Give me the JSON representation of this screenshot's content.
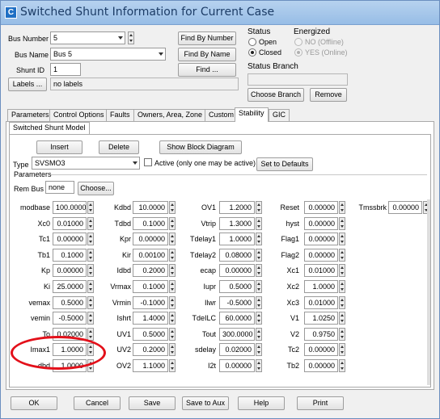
{
  "window": {
    "title": "Switched Shunt Information for Current Case",
    "app_icon_glyph": "C"
  },
  "bus_number": {
    "label": "Bus Number",
    "value": "5"
  },
  "bus_name": {
    "label": "Bus Name",
    "value": "Bus 5"
  },
  "shunt_id": {
    "label": "Shunt ID",
    "value": "1"
  },
  "labels": {
    "button": "Labels ...",
    "value": "no labels"
  },
  "find": {
    "by_number": "Find By Number",
    "by_name": "Find By Name",
    "find": "Find ..."
  },
  "status": {
    "title": "Status",
    "open": "Open",
    "closed": "Closed"
  },
  "energized": {
    "title": "Energized",
    "no": "NO (Offline)",
    "yes": "YES (Online)"
  },
  "status_branch": {
    "title": "Status Branch",
    "value": "",
    "choose": "Choose Branch",
    "remove": "Remove"
  },
  "tabs": [
    "Parameters",
    "Control Options",
    "Faults",
    "Owners, Area, Zone",
    "Custom",
    "Stability",
    "GIC"
  ],
  "subtab": "Switched Shunt Model",
  "model_buttons": {
    "insert": "Insert",
    "delete": "Delete",
    "show_block": "Show Block Diagram"
  },
  "type": {
    "label": "Type",
    "value": "SVSMO3",
    "active_label": "Active (only one may be active)",
    "set_defaults": "Set to Defaults"
  },
  "params_group": "Parameters",
  "rem_bus": {
    "label": "Rem Bus",
    "value": "none",
    "choose": "Choose..."
  },
  "params": [
    [
      {
        "name": "modbase",
        "value": "100.0000"
      },
      {
        "name": "Xc0",
        "value": "0.01000"
      },
      {
        "name": "Tc1",
        "value": "0.00000"
      },
      {
        "name": "Tb1",
        "value": "0.1000"
      },
      {
        "name": "Kp",
        "value": "0.00000"
      },
      {
        "name": "Ki",
        "value": "25.0000"
      },
      {
        "name": "vemax",
        "value": "0.5000"
      },
      {
        "name": "vemin",
        "value": "-0.5000"
      },
      {
        "name": "To",
        "value": "0.02000"
      },
      {
        "name": "Imax1",
        "value": "1.0000"
      },
      {
        "name": "dbd",
        "value": "1.0000"
      }
    ],
    [
      {
        "name": "Kdbd",
        "value": "10.0000"
      },
      {
        "name": "Tdbd",
        "value": "0.1000"
      },
      {
        "name": "Kpr",
        "value": "0.00000"
      },
      {
        "name": "Kir",
        "value": "0.00100"
      },
      {
        "name": "Idbd",
        "value": "0.2000"
      },
      {
        "name": "Vrmax",
        "value": "0.1000"
      },
      {
        "name": "Vrmin",
        "value": "-0.1000"
      },
      {
        "name": "Ishrt",
        "value": "1.4000"
      },
      {
        "name": "UV1",
        "value": "0.5000"
      },
      {
        "name": "UV2",
        "value": "0.2000"
      },
      {
        "name": "OV2",
        "value": "1.1000"
      }
    ],
    [
      {
        "name": "OV1",
        "value": "1.2000"
      },
      {
        "name": "Vtrip",
        "value": "1.3000"
      },
      {
        "name": "Tdelay1",
        "value": "1.0000"
      },
      {
        "name": "Tdelay2",
        "value": "0.08000"
      },
      {
        "name": "ecap",
        "value": "0.00000"
      },
      {
        "name": "Iupr",
        "value": "0.5000"
      },
      {
        "name": "Ilwr",
        "value": "-0.5000"
      },
      {
        "name": "TdeILC",
        "value": "60.0000"
      },
      {
        "name": "Tout",
        "value": "300.0000"
      },
      {
        "name": "sdelay",
        "value": "0.02000"
      },
      {
        "name": "I2t",
        "value": "0.00000"
      }
    ],
    [
      {
        "name": "Reset",
        "value": "0.00000"
      },
      {
        "name": "hyst",
        "value": "0.00000"
      },
      {
        "name": "Flag1",
        "value": "0.00000"
      },
      {
        "name": "Flag2",
        "value": "0.00000"
      },
      {
        "name": "Xc1",
        "value": "0.01000"
      },
      {
        "name": "Xc2",
        "value": "1.0000"
      },
      {
        "name": "Xc3",
        "value": "0.01000"
      },
      {
        "name": "V1",
        "value": "1.0250"
      },
      {
        "name": "V2",
        "value": "0.9750"
      },
      {
        "name": "Tc2",
        "value": "0.00000"
      },
      {
        "name": "Tb2",
        "value": "0.00000"
      }
    ],
    [
      {
        "name": "Tmssbrk",
        "value": "0.00000"
      }
    ]
  ],
  "bottom_buttons": {
    "ok": "OK",
    "cancel": "Cancel",
    "save": "Save",
    "save_aux": "Save to Aux",
    "help": "Help",
    "print": "Print"
  },
  "colors": {
    "title_bar": "#a8c8ec",
    "highlight": "#e3101a"
  }
}
